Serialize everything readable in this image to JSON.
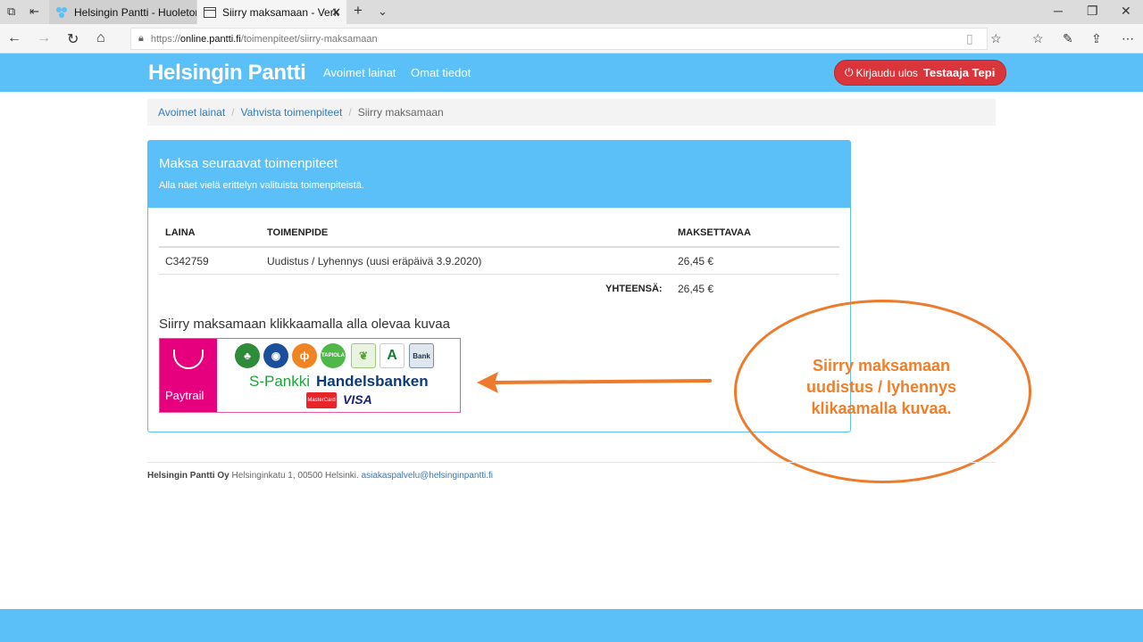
{
  "browser": {
    "tabs": [
      {
        "title": "Helsingin Pantti - Huoleton",
        "active": false
      },
      {
        "title": "Siirry maksamaan - Verk",
        "active": true
      }
    ],
    "url_scheme": "https://",
    "url_host": "online.pantti.fi",
    "url_path": "/toimenpiteet/siirry-maksamaan"
  },
  "header": {
    "brand": "Helsingin Pantti",
    "nav": [
      "Avoimet lainat",
      "Omat tiedot"
    ],
    "logout_label": "Kirjaudu ulos",
    "user_name": "Testaaja Tepi"
  },
  "breadcrumb": {
    "items": [
      "Avoimet lainat",
      "Vahvista toimenpiteet"
    ],
    "current": "Siirry maksamaan"
  },
  "panel": {
    "title": "Maksa seuraavat toimenpiteet",
    "subtitle": "Alla näet vielä erittelyn valituista toimenpiteistä.",
    "columns": [
      "LAINA",
      "TOIMENPIDE",
      "MAKSETTAVAA"
    ],
    "rows": [
      {
        "laina": "C342759",
        "toimenpide": "Uudistus / Lyhennys (uusi eräpäivä 3.9.2020)",
        "maksettavaa": "26,45 €"
      }
    ],
    "total_label": "YHTEENSÄ:",
    "total_value": "26,45 €",
    "pay_title": "Siirry maksamaan klikkaamalla alla olevaa kuvaa",
    "paytrail": {
      "brand": "Paytrail",
      "bank1": "S-Pankki",
      "bank2": "Handelsbanken",
      "card1": "MasterCard",
      "card2": "VISA"
    }
  },
  "annotation": {
    "line1": "Siirry maksamaan",
    "line2": "uudistus / lyhennys",
    "line3": "klikaamalla kuvaa.",
    "color": "#ef7f2a"
  },
  "footer": {
    "company": "Helsingin Pantti Oy",
    "address": "Helsinginkatu 1, 00500 Helsinki.",
    "email": "asiakaspalvelu@helsinginpantti.fi"
  },
  "colors": {
    "accent": "#5bc0f8",
    "logout": "#d9353a",
    "link": "#337ab7"
  }
}
